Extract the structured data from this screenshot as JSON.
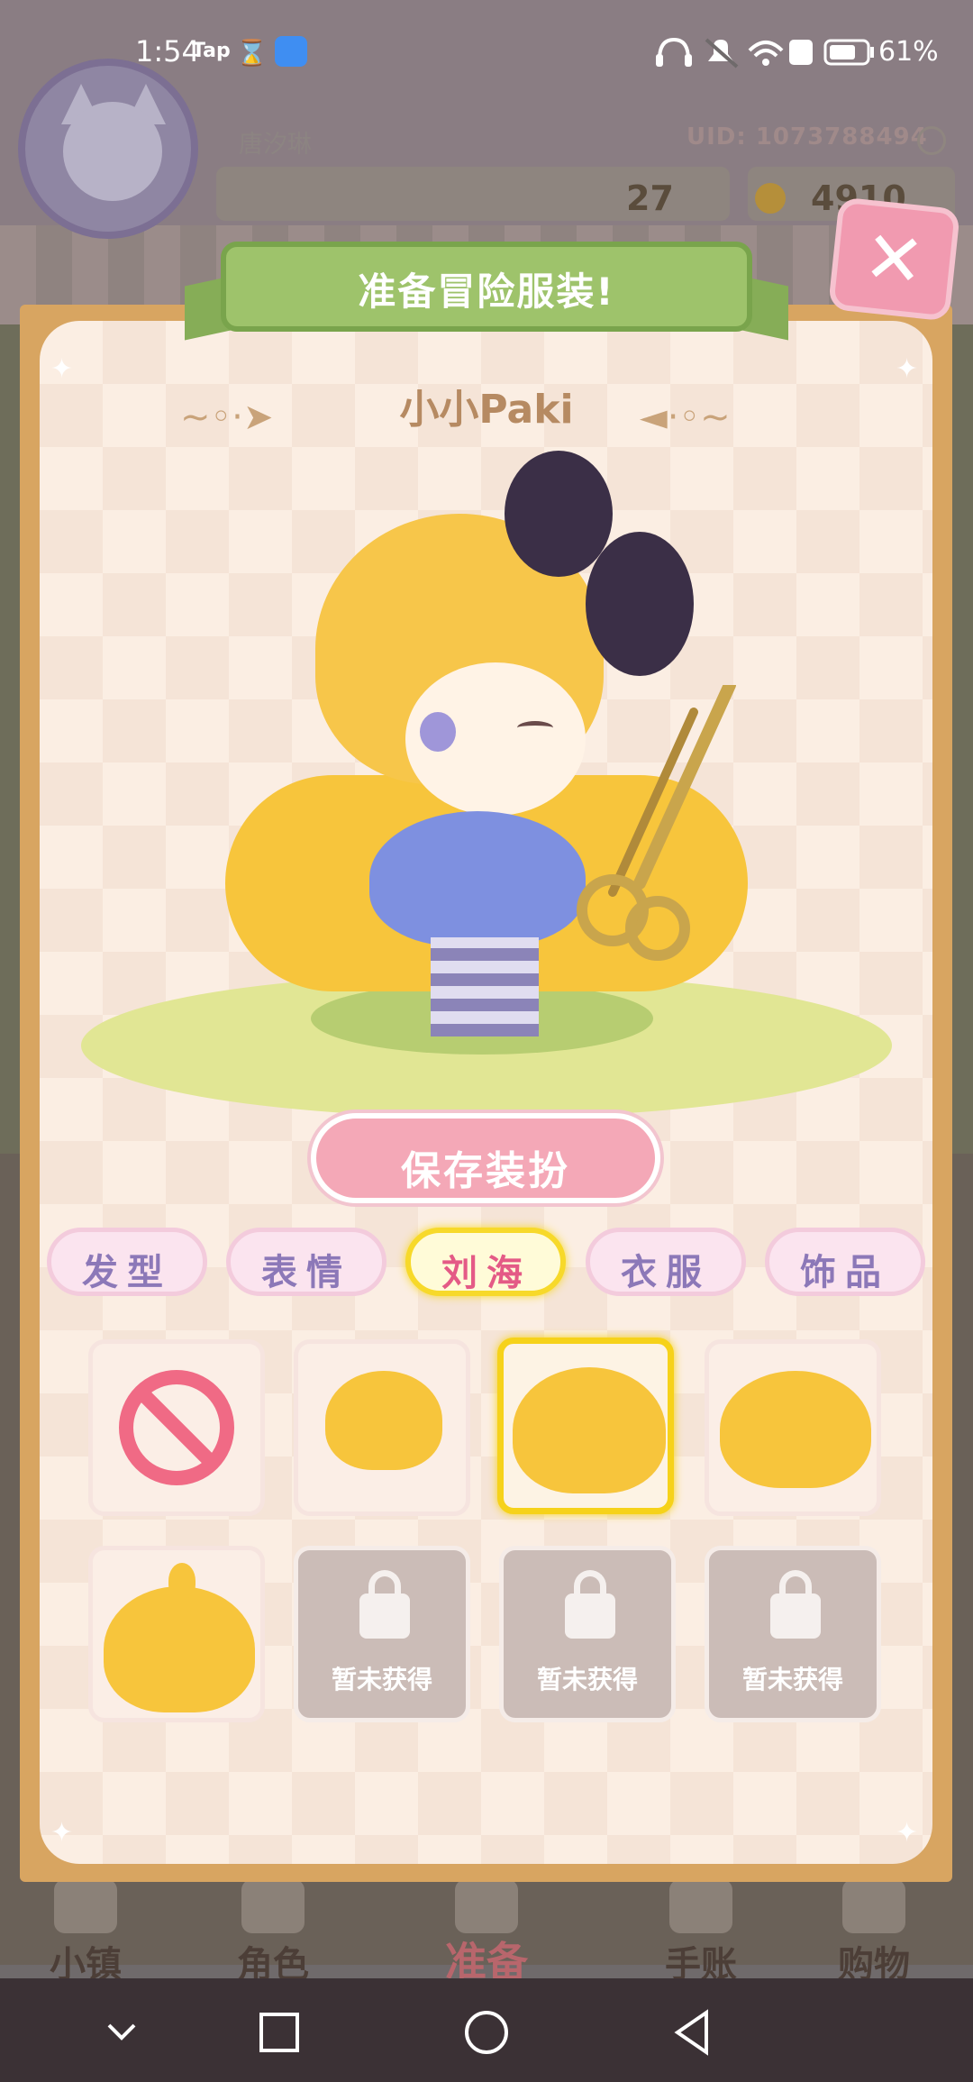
{
  "status_bar": {
    "time": "1:54",
    "app_tag": "Tap",
    "battery_percent": "61%"
  },
  "profile": {
    "username": "唐汐琳",
    "uid": "UID: 1073788494",
    "level": "27",
    "coins": "4910"
  },
  "dialog": {
    "title": "准备冒险服装!",
    "character_name": "小小Paki",
    "save_label": "保存装扮",
    "close_icon": "close-icon"
  },
  "tabs": [
    {
      "label": "发型",
      "active": false
    },
    {
      "label": "表情",
      "active": false
    },
    {
      "label": "刘海",
      "active": true
    },
    {
      "label": "衣服",
      "active": false
    },
    {
      "label": "饰品",
      "active": false
    }
  ],
  "items": [
    {
      "type": "none",
      "icon": "no-entry-icon"
    },
    {
      "type": "bangs",
      "icon": "bangs-short-icon"
    },
    {
      "type": "bangs",
      "icon": "bangs-full-icon",
      "selected": true
    },
    {
      "type": "bangs",
      "icon": "bangs-side-icon"
    },
    {
      "type": "bangs",
      "icon": "bangs-tuft-icon"
    },
    {
      "type": "locked",
      "label": "暂未获得"
    },
    {
      "type": "locked",
      "label": "暂未获得"
    },
    {
      "type": "locked",
      "label": "暂未获得"
    }
  ],
  "bottom_nav": [
    {
      "label": "小镇"
    },
    {
      "label": "角色"
    },
    {
      "label": "准备",
      "active": true
    },
    {
      "label": "手账"
    },
    {
      "label": "购物"
    }
  ],
  "colors": {
    "accent_pink": "#f4a8b7",
    "highlight_yellow": "#f7d92a",
    "frame_tan": "#d8a561",
    "banner_green": "#9ec36b"
  }
}
